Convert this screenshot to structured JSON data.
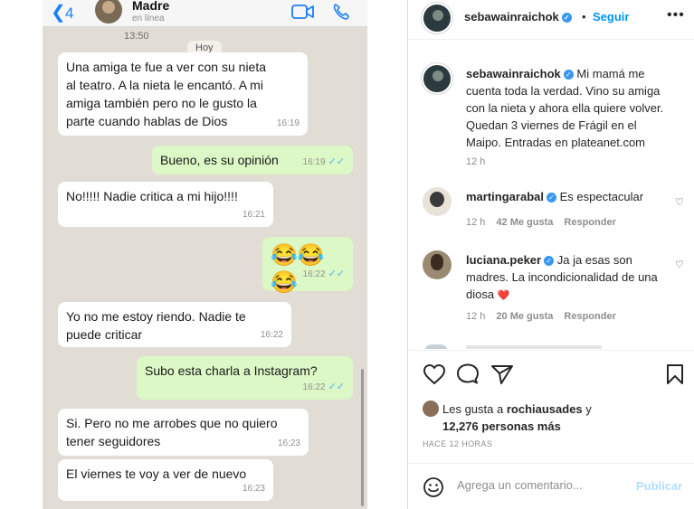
{
  "whatsapp": {
    "back_count": "4",
    "contact_name": "Madre",
    "contact_status": "en línea",
    "earlier_time": "13:50",
    "day_label": "Hoy",
    "messages": [
      {
        "direction": "in",
        "text": "Una amiga te fue a ver con su nieta\nal teatro. A la nieta le encantó. A mi\namiga también pero no le gusto la\nparte cuando hablas de Dios",
        "time": "16:19"
      },
      {
        "direction": "out",
        "text": "Bueno, es su opinión",
        "time": "16:19",
        "read": true
      },
      {
        "direction": "in",
        "text": "No!!!!! Nadie critica a mi hijo!!!!",
        "time": "16:21"
      },
      {
        "direction": "out",
        "text": "😂😂😂",
        "time": "16:22",
        "read": true
      },
      {
        "direction": "in",
        "text": "Yo no me estoy riendo. Nadie te\npuede criticar",
        "time": "16:22"
      },
      {
        "direction": "out",
        "text": "Subo esta charla a Instagram?",
        "time": "16:22",
        "read": true
      },
      {
        "direction": "in",
        "text": "Si. Pero no me arrobes que no quiero\ntener seguidores",
        "time": "16:23"
      },
      {
        "direction": "in",
        "text": "El viernes te voy a ver de nuevo",
        "time": "16:23"
      }
    ]
  },
  "instagram": {
    "header": {
      "username": "sebawainraichok",
      "separator": "•",
      "follow_label": "Seguir",
      "more_label": "•••"
    },
    "caption": {
      "username": "sebawainraichok",
      "text": "Mi mamá me cuenta toda la verdad. Vino su amiga con la nieta y ahora ella quiere volver. Quedan 3 viernes de Frágil en el Maipo. Entradas en plateanet.com",
      "age": "12 h"
    },
    "comments": [
      {
        "username": "martingarabal",
        "text": "Es espectacular",
        "age": "12 h",
        "likes": "42 Me gusta",
        "reply_label": "Responder"
      },
      {
        "username": "luciana.peker",
        "text": "Ja ja esas son madres. La incondicionalidad de una diosa",
        "emoji": "❤️",
        "age": "12 h",
        "likes": "20 Me gusta",
        "reply_label": "Responder"
      }
    ],
    "likes": {
      "prefix": "Les gusta a",
      "first_user": "rochiausades",
      "connector": "y",
      "others": "12,276 personas más"
    },
    "post_time": "HACE 12 HORAS",
    "add_comment": {
      "placeholder": "Agrega un comentario...",
      "publish_label": "Publicar"
    }
  },
  "colors": {
    "whatsapp_bg": "#e2ddd4",
    "incoming_bubble": "#ffffff",
    "outgoing_bubble": "#dcf8c6",
    "ios_blue": "#1d7ff5",
    "read_ticks": "#4fb6ec",
    "instagram_link": "#0095f6",
    "verified_badge": "#3897f0"
  }
}
